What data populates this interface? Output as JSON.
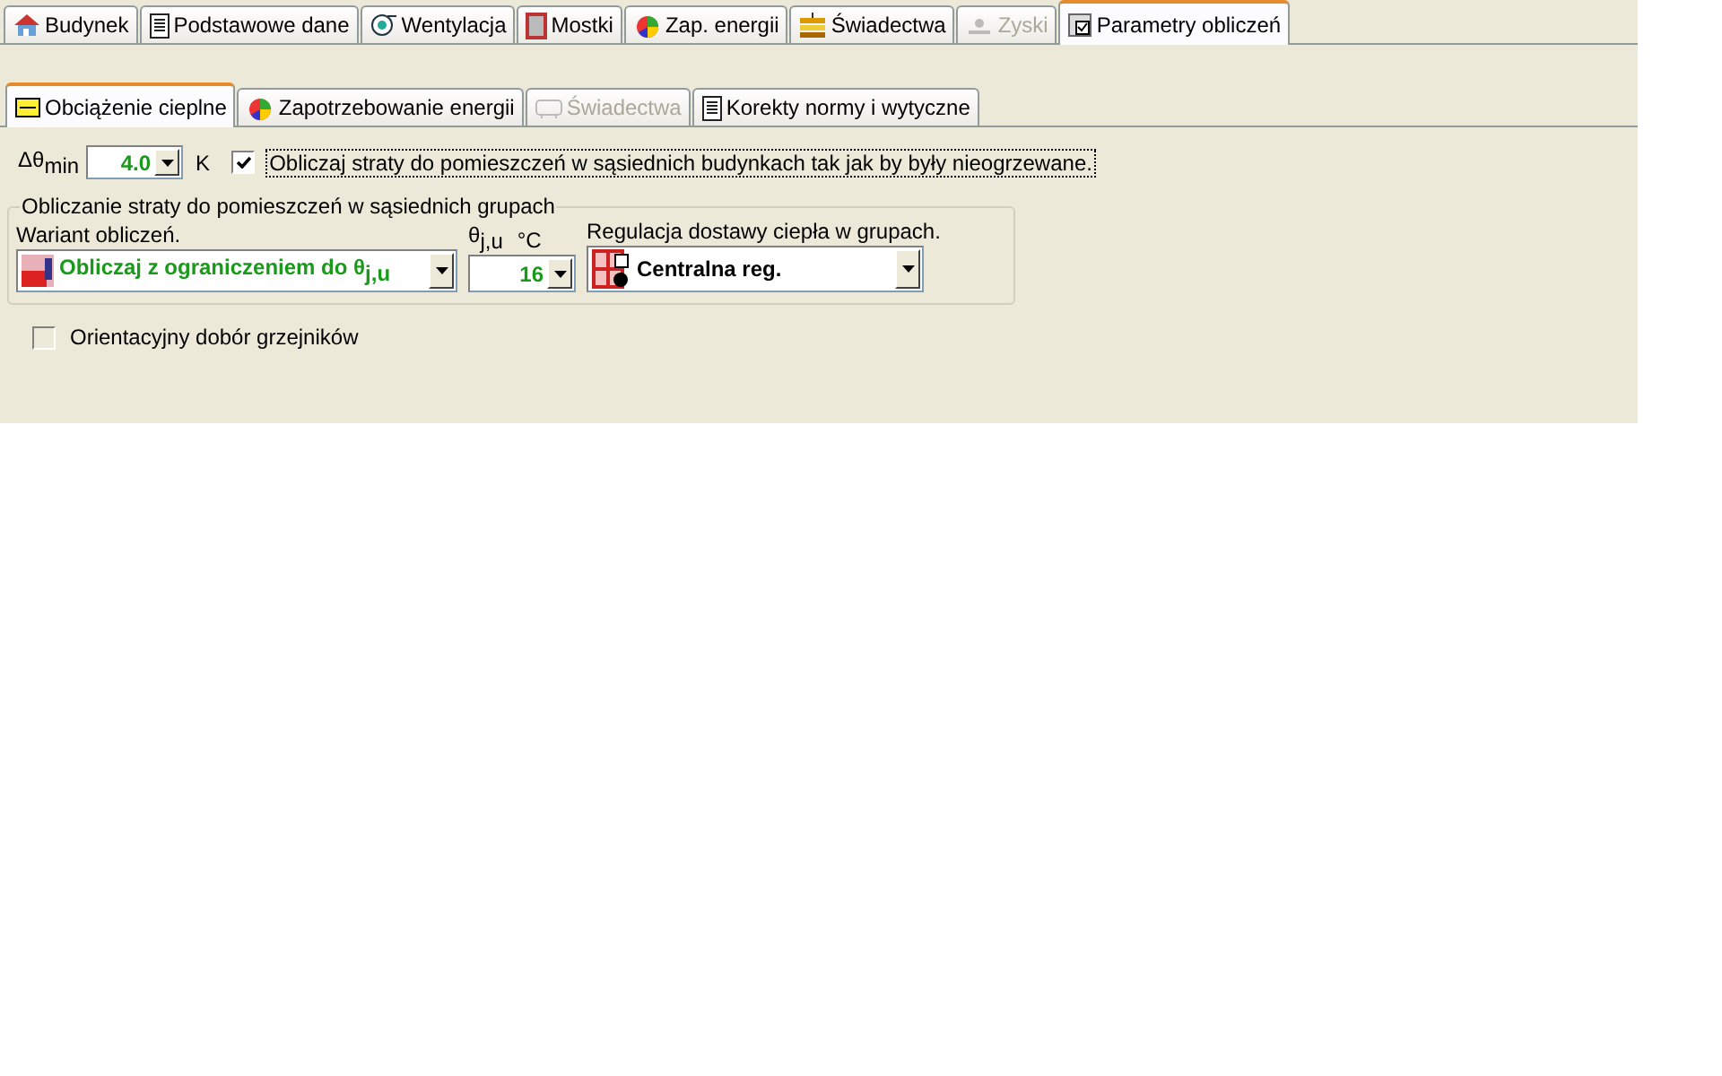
{
  "top_tabs": [
    {
      "label": "Budynek",
      "selected": false,
      "disabled": false
    },
    {
      "label": "Podstawowe dane",
      "selected": false,
      "disabled": false
    },
    {
      "label": "Wentylacja",
      "selected": false,
      "disabled": false
    },
    {
      "label": "Mostki",
      "selected": false,
      "disabled": false
    },
    {
      "label": "Zap. energii",
      "selected": false,
      "disabled": false
    },
    {
      "label": "Świadectwa",
      "selected": false,
      "disabled": false
    },
    {
      "label": "Zyski",
      "selected": false,
      "disabled": true
    },
    {
      "label": "Parametry obliczeń",
      "selected": true,
      "disabled": false
    }
  ],
  "sub_tabs": [
    {
      "label": "Obciążenie cieplne",
      "selected": true,
      "disabled": false
    },
    {
      "label": "Zapotrzebowanie energii",
      "selected": false,
      "disabled": false
    },
    {
      "label": "Świadectwa",
      "selected": false,
      "disabled": true
    },
    {
      "label": "Korekty normy i wytyczne",
      "selected": false,
      "disabled": false
    }
  ],
  "delta_min": {
    "label": "Δθ$_{min}$",
    "value": "4.0",
    "unit": "K"
  },
  "adjacent_buildings": {
    "label": "Obliczaj straty do pomieszczeń w sąsiednich budynkach tak jak by były nieogrzewane.",
    "checked": true
  },
  "group": {
    "title": "Obliczanie straty do pomieszczeń w sąsiednich grupach",
    "variant": {
      "label": "Wariant obliczeń.",
      "value": "Obliczaj z ograniczeniem do θ$_{j,u}$"
    },
    "theta": {
      "label": "θ$_{j,u}$",
      "unit": "°C",
      "value": "16"
    },
    "regulation": {
      "label": "Regulacja dostawy ciepła w grupach.",
      "value": "Centralna reg."
    }
  },
  "radiators": {
    "label": "Orientacyjny dobór grzejników",
    "checked": false
  }
}
